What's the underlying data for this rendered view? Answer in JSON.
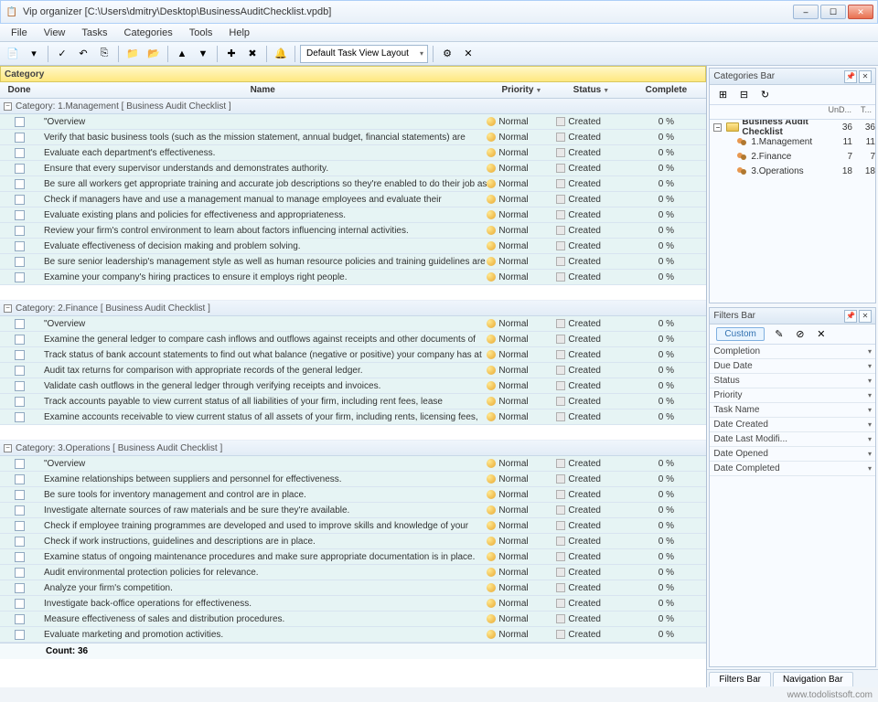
{
  "titlebar": {
    "title": "Vip organizer [C:\\Users\\dmitry\\Desktop\\BusinessAuditChecklist.vpdb]"
  },
  "menubar": [
    "File",
    "View",
    "Tasks",
    "Categories",
    "Tools",
    "Help"
  ],
  "toolbar": {
    "layout_select": "Default Task View Layout"
  },
  "category_label": "Category",
  "columns": {
    "done": "Done",
    "name": "Name",
    "priority": "Priority",
    "status": "Status",
    "complete": "Complete"
  },
  "groups": [
    {
      "header": "Category: 1.Management    [ Business Audit Checklist ]",
      "tasks": [
        {
          "name": "\"Overview",
          "priority": "Normal",
          "status": "Created",
          "complete": "0 %"
        },
        {
          "name": "Verify that basic business tools (such as the mission statement, annual budget, financial statements) are",
          "priority": "Normal",
          "status": "Created",
          "complete": "0 %"
        },
        {
          "name": "Evaluate each department's effectiveness.",
          "priority": "Normal",
          "status": "Created",
          "complete": "0 %"
        },
        {
          "name": "Ensure that every supervisor understands and demonstrates authority.",
          "priority": "Normal",
          "status": "Created",
          "complete": "0 %"
        },
        {
          "name": "Be sure all workers get appropriate training and accurate job descriptions so they're enabled to do their job as",
          "priority": "Normal",
          "status": "Created",
          "complete": "0 %"
        },
        {
          "name": "Check if managers have and use a management manual to manage employees and evaluate their",
          "priority": "Normal",
          "status": "Created",
          "complete": "0 %"
        },
        {
          "name": "Evaluate existing plans and policies for effectiveness and appropriateness.",
          "priority": "Normal",
          "status": "Created",
          "complete": "0 %"
        },
        {
          "name": "Review your firm's control environment to learn about factors influencing internal activities.",
          "priority": "Normal",
          "status": "Created",
          "complete": "0 %"
        },
        {
          "name": "Evaluate effectiveness of decision making and problem solving.",
          "priority": "Normal",
          "status": "Created",
          "complete": "0 %"
        },
        {
          "name": "Be sure senior leadership's management style as well as human resource policies and training guidelines are",
          "priority": "Normal",
          "status": "Created",
          "complete": "0 %"
        },
        {
          "name": "Examine your company's hiring practices to ensure it employs right people.",
          "priority": "Normal",
          "status": "Created",
          "complete": "0 %"
        }
      ]
    },
    {
      "header": "Category: 2.Finance    [ Business Audit Checklist ]",
      "tasks": [
        {
          "name": "\"Overview",
          "priority": "Normal",
          "status": "Created",
          "complete": "0 %"
        },
        {
          "name": "Examine the general ledger to compare cash inflows and outflows against receipts and other documents of",
          "priority": "Normal",
          "status": "Created",
          "complete": "0 %"
        },
        {
          "name": "Track status of bank account statements to find out what balance (negative or positive) your company has at",
          "priority": "Normal",
          "status": "Created",
          "complete": "0 %"
        },
        {
          "name": "Audit tax returns for comparison with appropriate records of the general ledger.",
          "priority": "Normal",
          "status": "Created",
          "complete": "0 %"
        },
        {
          "name": "Validate cash outflows in the general ledger through verifying receipts and invoices.",
          "priority": "Normal",
          "status": "Created",
          "complete": "0 %"
        },
        {
          "name": "Track accounts payable to view current status of all liabilities of your firm, including rent fees, lease",
          "priority": "Normal",
          "status": "Created",
          "complete": "0 %"
        },
        {
          "name": "Examine accounts receivable to view current status of all assets of your firm, including rents, licensing fees,",
          "priority": "Normal",
          "status": "Created",
          "complete": "0 %"
        }
      ]
    },
    {
      "header": "Category: 3.Operations    [ Business Audit Checklist ]",
      "tasks": [
        {
          "name": "\"Overview",
          "priority": "Normal",
          "status": "Created",
          "complete": "0 %"
        },
        {
          "name": "Examine relationships between suppliers and personnel for effectiveness.",
          "priority": "Normal",
          "status": "Created",
          "complete": "0 %"
        },
        {
          "name": "Be sure tools for inventory management and control are in place.",
          "priority": "Normal",
          "status": "Created",
          "complete": "0 %"
        },
        {
          "name": "Investigate alternate sources of raw materials and be sure they're available.",
          "priority": "Normal",
          "status": "Created",
          "complete": "0 %"
        },
        {
          "name": "Check if employee training programmes are developed and used to improve skills and knowledge of your",
          "priority": "Normal",
          "status": "Created",
          "complete": "0 %"
        },
        {
          "name": "Check if work instructions, guidelines and descriptions are in place.",
          "priority": "Normal",
          "status": "Created",
          "complete": "0 %"
        },
        {
          "name": "Examine status of ongoing maintenance procedures and make sure appropriate documentation is in place.",
          "priority": "Normal",
          "status": "Created",
          "complete": "0 %"
        },
        {
          "name": "Audit environmental protection policies for relevance.",
          "priority": "Normal",
          "status": "Created",
          "complete": "0 %"
        },
        {
          "name": "Analyze your firm's competition.",
          "priority": "Normal",
          "status": "Created",
          "complete": "0 %"
        },
        {
          "name": "Investigate back-office operations for effectiveness.",
          "priority": "Normal",
          "status": "Created",
          "complete": "0 %"
        },
        {
          "name": "Measure effectiveness of sales and distribution procedures.",
          "priority": "Normal",
          "status": "Created",
          "complete": "0 %"
        },
        {
          "name": "Evaluate marketing and promotion activities.",
          "priority": "Normal",
          "status": "Created",
          "complete": "0 %"
        }
      ]
    }
  ],
  "count_label": "Count: 36",
  "categories_panel": {
    "title": "Categories Bar",
    "header_cols": [
      "",
      "UnD...",
      "T..."
    ],
    "tree": [
      {
        "name": "Business Audit Checklist",
        "undone": "36",
        "total": "36",
        "root": true
      },
      {
        "name": "1.Management",
        "undone": "11",
        "total": "11"
      },
      {
        "name": "2.Finance",
        "undone": "7",
        "total": "7"
      },
      {
        "name": "3.Operations",
        "undone": "18",
        "total": "18"
      }
    ]
  },
  "filters_panel": {
    "title": "Filters Bar",
    "custom_chip": "Custom",
    "fields": [
      "Completion",
      "Due Date",
      "Status",
      "Priority",
      "Task Name",
      "Date Created",
      "Date Last Modifi...",
      "Date Opened",
      "Date Completed"
    ]
  },
  "bottom_tabs": [
    "Filters Bar",
    "Navigation Bar"
  ],
  "footer_watermark": "www.todolistsoft.com"
}
